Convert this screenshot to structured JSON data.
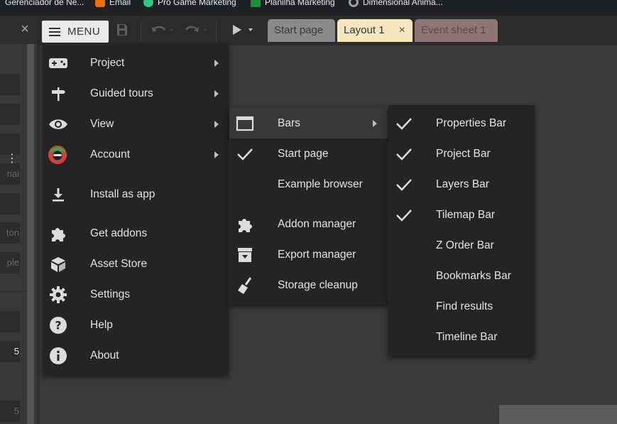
{
  "bookmarks": [
    {
      "label": "Gerenciador de Ne...",
      "icon": "none",
      "color": "#202124"
    },
    {
      "label": "Email",
      "icon": "orange-logo-icon",
      "color": "#e8710a"
    },
    {
      "label": "Pro Game Marketing",
      "icon": "green-logo-icon",
      "color": "#34c48a"
    },
    {
      "label": "Planilha Marketing",
      "icon": "sheets-icon",
      "color": "#1e8e3e"
    },
    {
      "label": "Dimensional Anima...",
      "icon": "c-logo-icon",
      "color": "#9aa0a6"
    }
  ],
  "left_panel": {
    "fields": [
      "",
      "",
      "",
      "nai",
      "",
      "ton",
      "ple",
      "",
      "5",
      "5"
    ]
  },
  "toolbar": {
    "menu_label": "MENU"
  },
  "tabs": [
    {
      "label": "Start page"
    },
    {
      "label": "Layout 1",
      "close": "×"
    },
    {
      "label": "Event sheet 1"
    }
  ],
  "main_menu": {
    "items": [
      {
        "label": "Project",
        "icon": "gamepad-icon",
        "submenu": true
      },
      {
        "label": "Guided tours",
        "icon": "signpost-icon",
        "submenu": true
      },
      {
        "label": "View",
        "icon": "eye-icon",
        "submenu": true
      },
      {
        "label": "Account",
        "icon": "avatar-icon",
        "submenu": true
      },
      {
        "label": "Install as app",
        "icon": "download-icon",
        "submenu": false
      },
      {
        "label": "Get addons",
        "icon": "puzzle-icon",
        "submenu": false
      },
      {
        "label": "Asset Store",
        "icon": "box-icon",
        "submenu": false
      },
      {
        "label": "Settings",
        "icon": "gear-icon",
        "submenu": false
      },
      {
        "label": "Help",
        "icon": "help-icon",
        "submenu": false
      },
      {
        "label": "About",
        "icon": "info-icon",
        "submenu": false
      }
    ]
  },
  "view_menu": {
    "items": [
      {
        "label": "Bars",
        "icon": "window-icon",
        "submenu": true,
        "highlighted": true
      },
      {
        "label": "Start page",
        "icon": "check-icon",
        "checked": true
      },
      {
        "label": "Example browser",
        "icon": "none"
      },
      {
        "label": "Addon manager",
        "icon": "puzzle-icon"
      },
      {
        "label": "Export manager",
        "icon": "export-box-icon"
      },
      {
        "label": "Storage cleanup",
        "icon": "broom-icon"
      }
    ]
  },
  "bars_menu": {
    "items": [
      {
        "label": "Properties Bar",
        "checked": true
      },
      {
        "label": "Project Bar",
        "checked": true
      },
      {
        "label": "Layers Bar",
        "checked": true
      },
      {
        "label": "Tilemap Bar",
        "checked": true
      },
      {
        "label": "Z Order Bar",
        "checked": false
      },
      {
        "label": "Bookmarks Bar",
        "checked": false
      },
      {
        "label": "Find results",
        "checked": false
      },
      {
        "label": "Timeline Bar",
        "checked": false
      }
    ]
  }
}
